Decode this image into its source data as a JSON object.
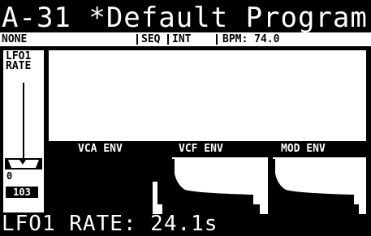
{
  "header": {
    "title": "A-31 *Default Program"
  },
  "status": {
    "mode": "NONE",
    "seq": "SEQ",
    "int": "INT",
    "bpm": "BPM: 74.0"
  },
  "lfo": {
    "label_line1": "LFO1",
    "label_line2": "RATE",
    "min_label": "0",
    "value": "103"
  },
  "envelopes": [
    {
      "label": "VCA ENV"
    },
    {
      "label": "VCF ENV"
    },
    {
      "label": "MOD ENV"
    }
  ],
  "footer": {
    "param_text": "LFO1 RATE: 24.1s"
  },
  "colors": {
    "foreground": "#ffffff",
    "background": "#000000"
  }
}
